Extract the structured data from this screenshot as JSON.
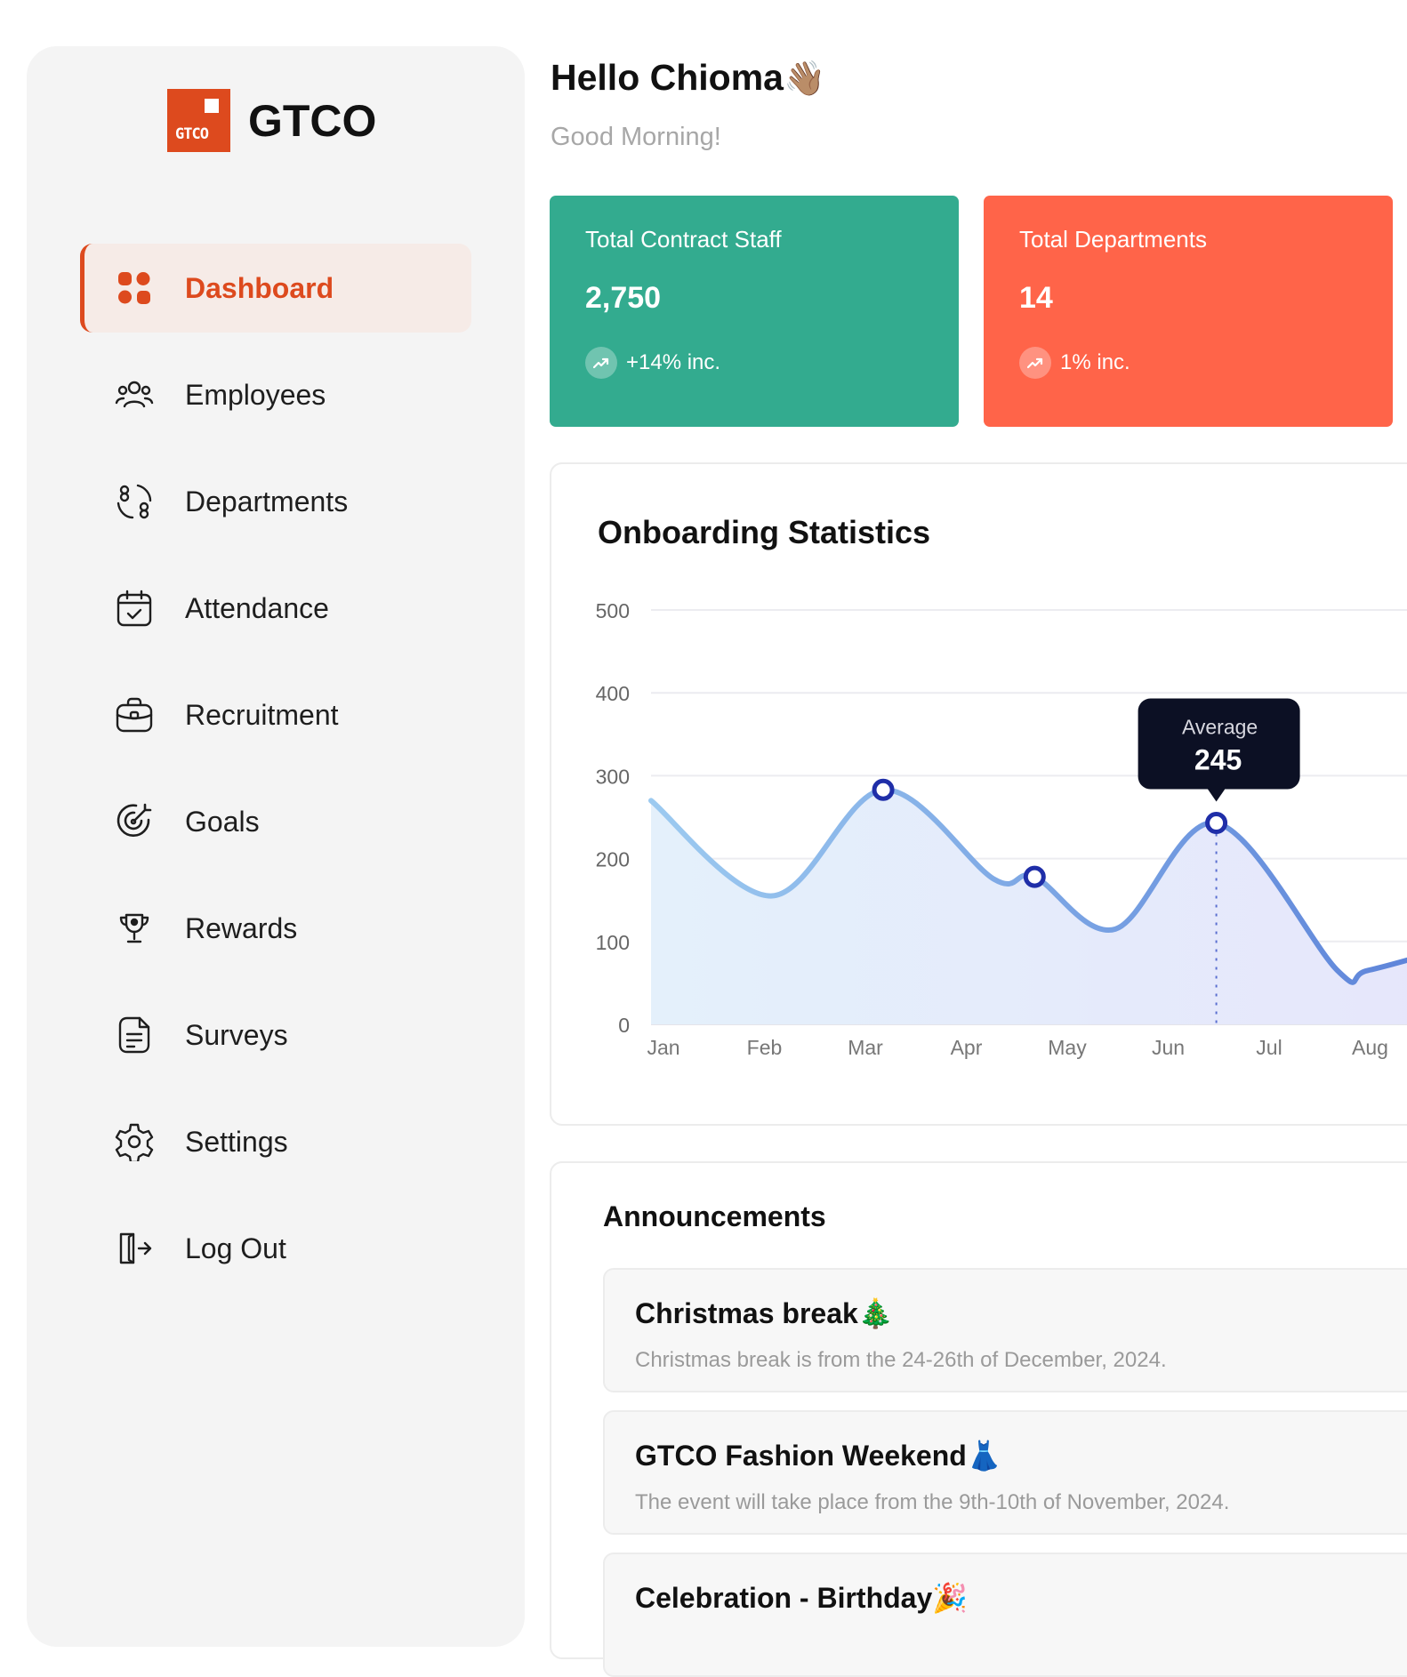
{
  "brand": {
    "logo_mark_text": "GTCO",
    "name": "GTCO",
    "accent": "#dd4a1e"
  },
  "sidebar": {
    "items": [
      {
        "label": "Dashboard",
        "icon": "dashboard-grid-icon",
        "active": true
      },
      {
        "label": "Employees",
        "icon": "users-icon"
      },
      {
        "label": "Departments",
        "icon": "departments-icon"
      },
      {
        "label": "Attendance",
        "icon": "calendar-check-icon"
      },
      {
        "label": "Recruitment",
        "icon": "briefcase-icon"
      },
      {
        "label": "Goals",
        "icon": "target-icon"
      },
      {
        "label": "Rewards",
        "icon": "trophy-icon"
      },
      {
        "label": "Surveys",
        "icon": "document-icon"
      },
      {
        "label": "Settings",
        "icon": "gear-icon"
      },
      {
        "label": "Log Out",
        "icon": "logout-icon"
      }
    ]
  },
  "header": {
    "hello": "Hello Chioma",
    "wave_emoji": "👋🏽",
    "greeting": "Good Morning!"
  },
  "stats": [
    {
      "title": "Total Contract Staff",
      "value": "2,750",
      "trend": "+14% inc.",
      "color": "#33ab8f"
    },
    {
      "title": "Total Departments",
      "value": "14",
      "trend": "1% inc.",
      "color": "#ff6449"
    }
  ],
  "onboarding": {
    "title": "Onboarding Statistics",
    "tooltip": {
      "label": "Average",
      "value": "245"
    }
  },
  "chart_data": {
    "type": "area",
    "categories": [
      "Jan",
      "Feb",
      "Mar",
      "Apr",
      "May",
      "Jun",
      "Jul",
      "Aug"
    ],
    "series": [
      {
        "x": [
          0,
          1.2,
          2.3,
          3.4,
          3.8,
          4.6,
          5.6,
          6.8,
          7.1,
          8.0
        ],
        "y": [
          270,
          155,
          283,
          175,
          178,
          115,
          243,
          65,
          65,
          95
        ]
      }
    ],
    "markers_at": [
      2,
      4,
      6
    ],
    "highlight_index": 6,
    "yticks": [
      0,
      100,
      200,
      300,
      400,
      500
    ],
    "ylim": [
      0,
      500
    ],
    "grid": true,
    "line_color_start": "#9ccaf0",
    "line_color_end": "#5a80d8",
    "marker_color": "#1f2ea8"
  },
  "announcements": {
    "title": "Announcements",
    "items": [
      {
        "title": "Christmas break",
        "emoji": "🎄",
        "desc": "Christmas break is from the 24-26th of December, 2024."
      },
      {
        "title": "GTCO Fashion Weekend",
        "emoji": "👗",
        "desc": "The event will take place from the 9th-10th of November, 2024."
      },
      {
        "title": "Celebration - Birthday",
        "emoji": "🎉",
        "desc": ""
      }
    ]
  }
}
